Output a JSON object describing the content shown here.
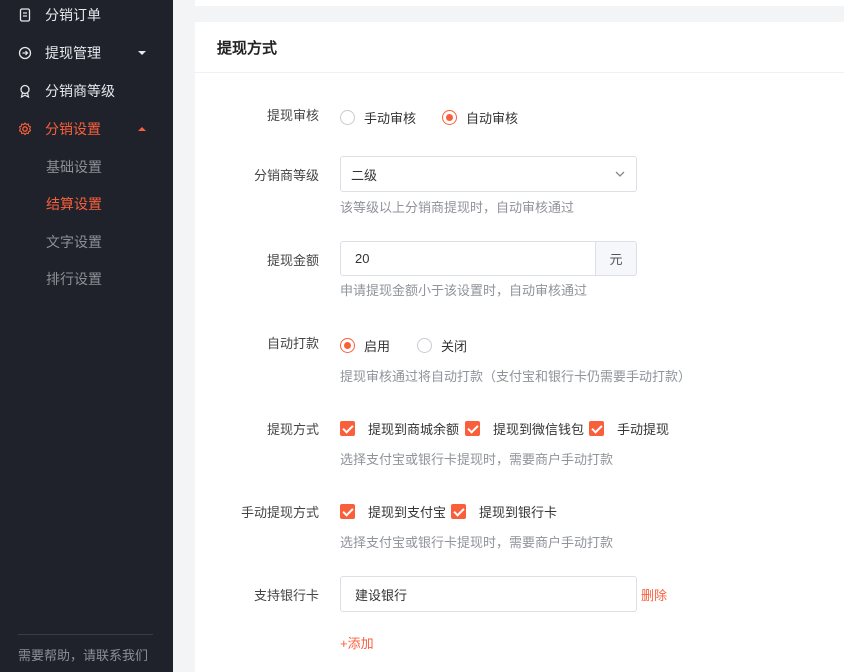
{
  "sidebar": {
    "items": [
      {
        "label": "分销订单",
        "icon": "document-icon"
      },
      {
        "label": "提现管理",
        "icon": "withdraw-icon"
      },
      {
        "label": "分销商等级",
        "icon": "badge-icon"
      },
      {
        "label": "分销设置",
        "icon": "gear-icon"
      }
    ],
    "sub_items": [
      {
        "label": "基础设置"
      },
      {
        "label": "结算设置"
      },
      {
        "label": "文字设置"
      },
      {
        "label": "排行设置"
      }
    ],
    "help_text": "需要帮助，请联系我们",
    "accent_color": "#fa5f3c",
    "background_color": "#1f222a"
  },
  "card": {
    "title": "提现方式"
  },
  "form": {
    "review": {
      "label": "提现审核",
      "options": [
        "手动审核",
        "自动审核"
      ],
      "selected": "自动审核"
    },
    "level": {
      "label": "分销商等级",
      "value": "二级",
      "hint": "该等级以上分销商提现时，自动审核通过"
    },
    "amount": {
      "label": "提现金额",
      "value": "20",
      "suffix": "元",
      "hint": "申请提现金额小于该设置时，自动审核通过"
    },
    "auto_pay": {
      "label": "自动打款",
      "options": [
        "启用",
        "关闭"
      ],
      "selected": "启用",
      "hint": "提现审核通过将自动打款（支付宝和银行卡仍需要手动打款）"
    },
    "methods": {
      "label": "提现方式",
      "options": [
        "提现到商城余额",
        "提现到微信钱包",
        "手动提现"
      ],
      "checked": [
        true,
        true,
        true
      ],
      "hint": "选择支付宝或银行卡提现时，需要商户手动打款"
    },
    "manual_methods": {
      "label": "手动提现方式",
      "options": [
        "提现到支付宝",
        "提现到银行卡"
      ],
      "checked": [
        true,
        true
      ],
      "hint": "选择支付宝或银行卡提现时，需要商户手动打款"
    },
    "banks": {
      "label": "支持银行卡",
      "value": "建设银行",
      "delete_label": "删除",
      "add_label": "+添加"
    }
  }
}
